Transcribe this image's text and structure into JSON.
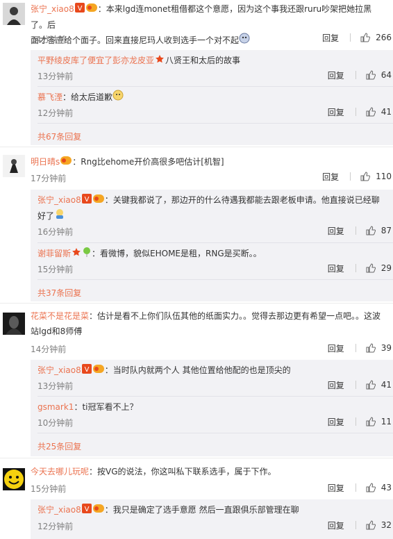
{
  "comments": [
    {
      "user": "张宁_xiao8",
      "text_line1": "：本来lgd连monet租借都这个意愿，因为这个事我还跟ruru吵架把她拉黑了。后",
      "text_line2": "面才答应给个面子。回来直接尼玛人收到选手一个对不起",
      "time": "14分钟前",
      "reply_label": "回复",
      "likes": "266",
      "replies": [
        {
          "user": "平野绫皮库了便宜了彭亦龙皮亚",
          "text": "八贤王和太后的故事",
          "time": "13分钟前",
          "reply_label": "回复",
          "likes": "64"
        },
        {
          "user": "慕飞湮",
          "text": "：给太后道歉",
          "time": "12分钟前",
          "reply_label": "回复",
          "likes": "41"
        }
      ],
      "more": "共67条回复"
    },
    {
      "user": "明日晴s",
      "text_line1": "：Rng比ehome开价高很多吧估计[机智]",
      "time": "17分钟前",
      "reply_label": "回复",
      "likes": "110",
      "replies": [
        {
          "user": "张宁_xiao8",
          "text_line1": "：关键我都说了，那边开的什么待遇我都能去跟老板申请。他直接说已经聊",
          "text_line2": "好了",
          "time": "16分钟前",
          "reply_label": "回复",
          "likes": "87"
        },
        {
          "user": "谢菲留斯",
          "text": "：看微博，貌似EHOME是租，RNG是买断。。",
          "time": "15分钟前",
          "reply_label": "回复",
          "likes": "29"
        }
      ],
      "more": "共37条回复"
    },
    {
      "user": "花菜不是花是菜",
      "text_line1": "：估计是看不上你们队伍其他的纸面实力。。觉得去那边更有希望一点吧。。这波",
      "text_line2": "站lgd和8师傅",
      "time": "14分钟前",
      "reply_label": "回复",
      "likes": "39",
      "replies": [
        {
          "user": "张宁_xiao8",
          "text": "：当时队内就两个人 其他位置给他配的也是顶尖的",
          "time": "13分钟前",
          "reply_label": "回复",
          "likes": "41"
        },
        {
          "user": "gsmark1",
          "text": "：ti冠军看不上？",
          "time": "10分钟前",
          "reply_label": "回复",
          "likes": "11"
        }
      ],
      "more": "共25条回复"
    },
    {
      "user": "今天去哪儿玩呢",
      "text_line1": "：按VG的说法，你这叫私下联系选手，属于下作。",
      "time": "15分钟前",
      "reply_label": "回复",
      "likes": "43",
      "replies": [
        {
          "user": "张宁_xiao8",
          "text": "：我只是确定了选手意愿 然后一直跟俱乐部管理在聊",
          "time": "12分钟前",
          "reply_label": "回复",
          "likes": "32"
        }
      ]
    }
  ],
  "colors": {
    "username": "#eb7350",
    "time": "#808080",
    "reply_bg": "#f2f2f5",
    "badge_red": "#e8491d"
  },
  "icons": [
    "thumb-up-icon",
    "verified-v-icon",
    "member-badge-icon",
    "emoji-icon",
    "red-star-icon"
  ]
}
